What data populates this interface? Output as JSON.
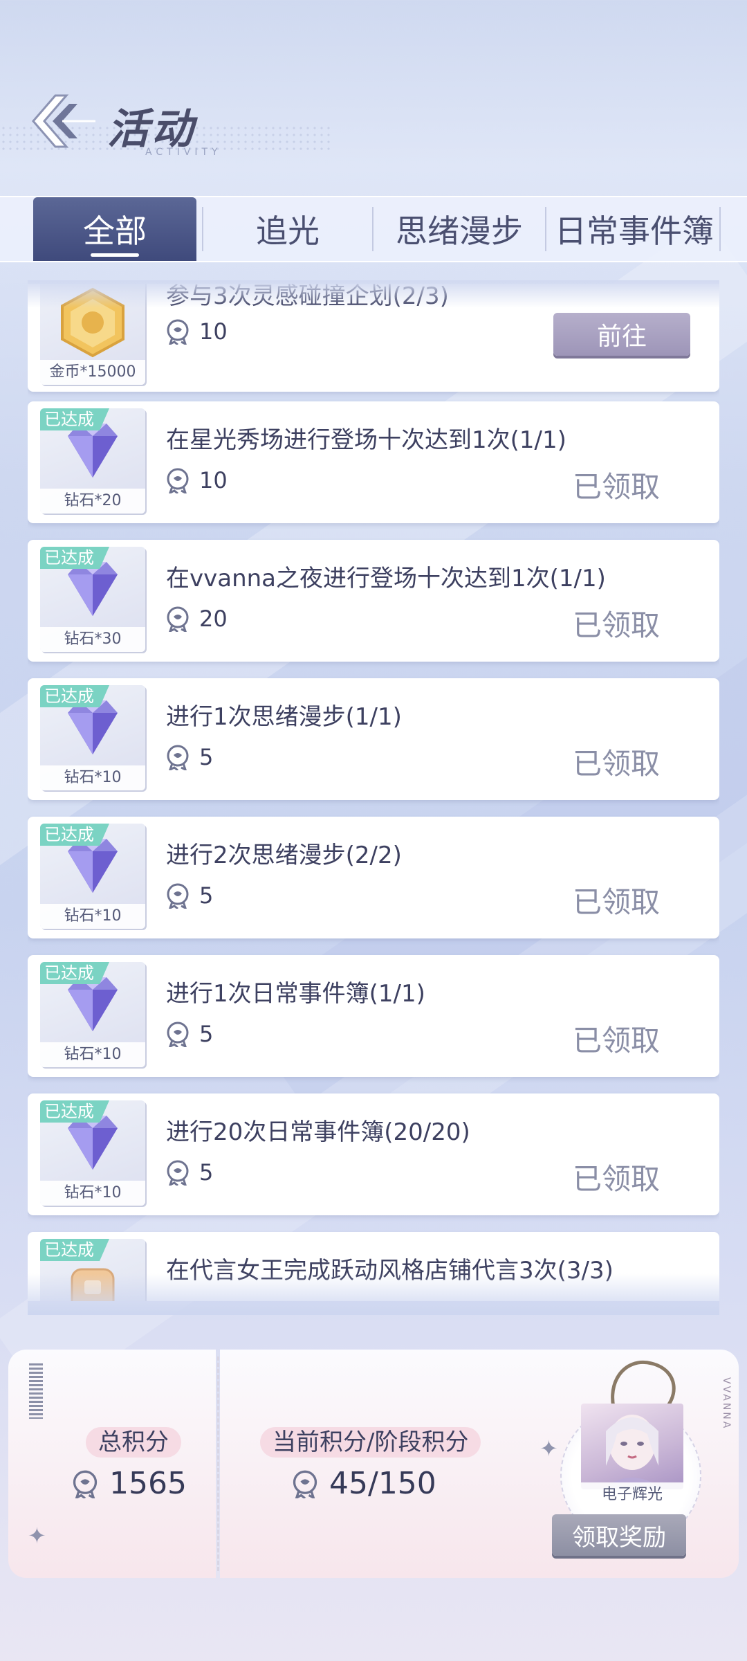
{
  "header": {
    "title": "活动",
    "subtitle": "ACTIVITY"
  },
  "tabs": [
    {
      "label": "全部",
      "active": true
    },
    {
      "label": "追光",
      "active": false
    },
    {
      "label": "思绪漫步",
      "active": false
    },
    {
      "label": "日常事件簿",
      "active": false
    }
  ],
  "tasks": [
    {
      "reward_label": "金币*15000",
      "reward_type": "coin-icon",
      "title": "参与3次灵感碰撞企划(2/3)",
      "points": "10",
      "completed": false,
      "action_label": "前往"
    },
    {
      "reward_label": "钻石*20",
      "reward_type": "diamond-icon",
      "badge": "已达成",
      "title": "在星光秀场进行登场十次达到1次(1/1)",
      "points": "10",
      "completed": true,
      "action_label": "已领取"
    },
    {
      "reward_label": "钻石*30",
      "reward_type": "diamond-icon",
      "badge": "已达成",
      "title": "在vvanna之夜进行登场十次达到1次(1/1)",
      "points": "20",
      "completed": true,
      "action_label": "已领取"
    },
    {
      "reward_label": "钻石*10",
      "reward_type": "diamond-icon",
      "badge": "已达成",
      "title": "进行1次思绪漫步(1/1)",
      "points": "5",
      "completed": true,
      "action_label": "已领取"
    },
    {
      "reward_label": "钻石*10",
      "reward_type": "diamond-icon",
      "badge": "已达成",
      "title": "进行2次思绪漫步(2/2)",
      "points": "5",
      "completed": true,
      "action_label": "已领取"
    },
    {
      "reward_label": "钻石*10",
      "reward_type": "diamond-icon",
      "badge": "已达成",
      "title": "进行1次日常事件簿(1/1)",
      "points": "5",
      "completed": true,
      "action_label": "已领取"
    },
    {
      "reward_label": "钻石*10",
      "reward_type": "diamond-icon",
      "badge": "已达成",
      "title": "进行20次日常事件簿(20/20)",
      "points": "5",
      "completed": true,
      "action_label": "已领取"
    },
    {
      "reward_label": "",
      "reward_type": "accessory-icon",
      "badge": "已达成",
      "title": "在代言女王完成跃动风格店铺代言3次(3/3)",
      "points": "",
      "completed": true,
      "action_label": ""
    }
  ],
  "summary": {
    "total_label": "总积分",
    "total_value": "1565",
    "current_label": "当前积分/阶段积分",
    "current_value": "45/150",
    "reward_name": "电子辉光",
    "claim_label": "领取奖励",
    "brand_vertical": "VVANNA"
  },
  "colors": {
    "accent": "#3f4a7c",
    "badge": "#7bd3c3",
    "go_button": "#9d95b8"
  }
}
